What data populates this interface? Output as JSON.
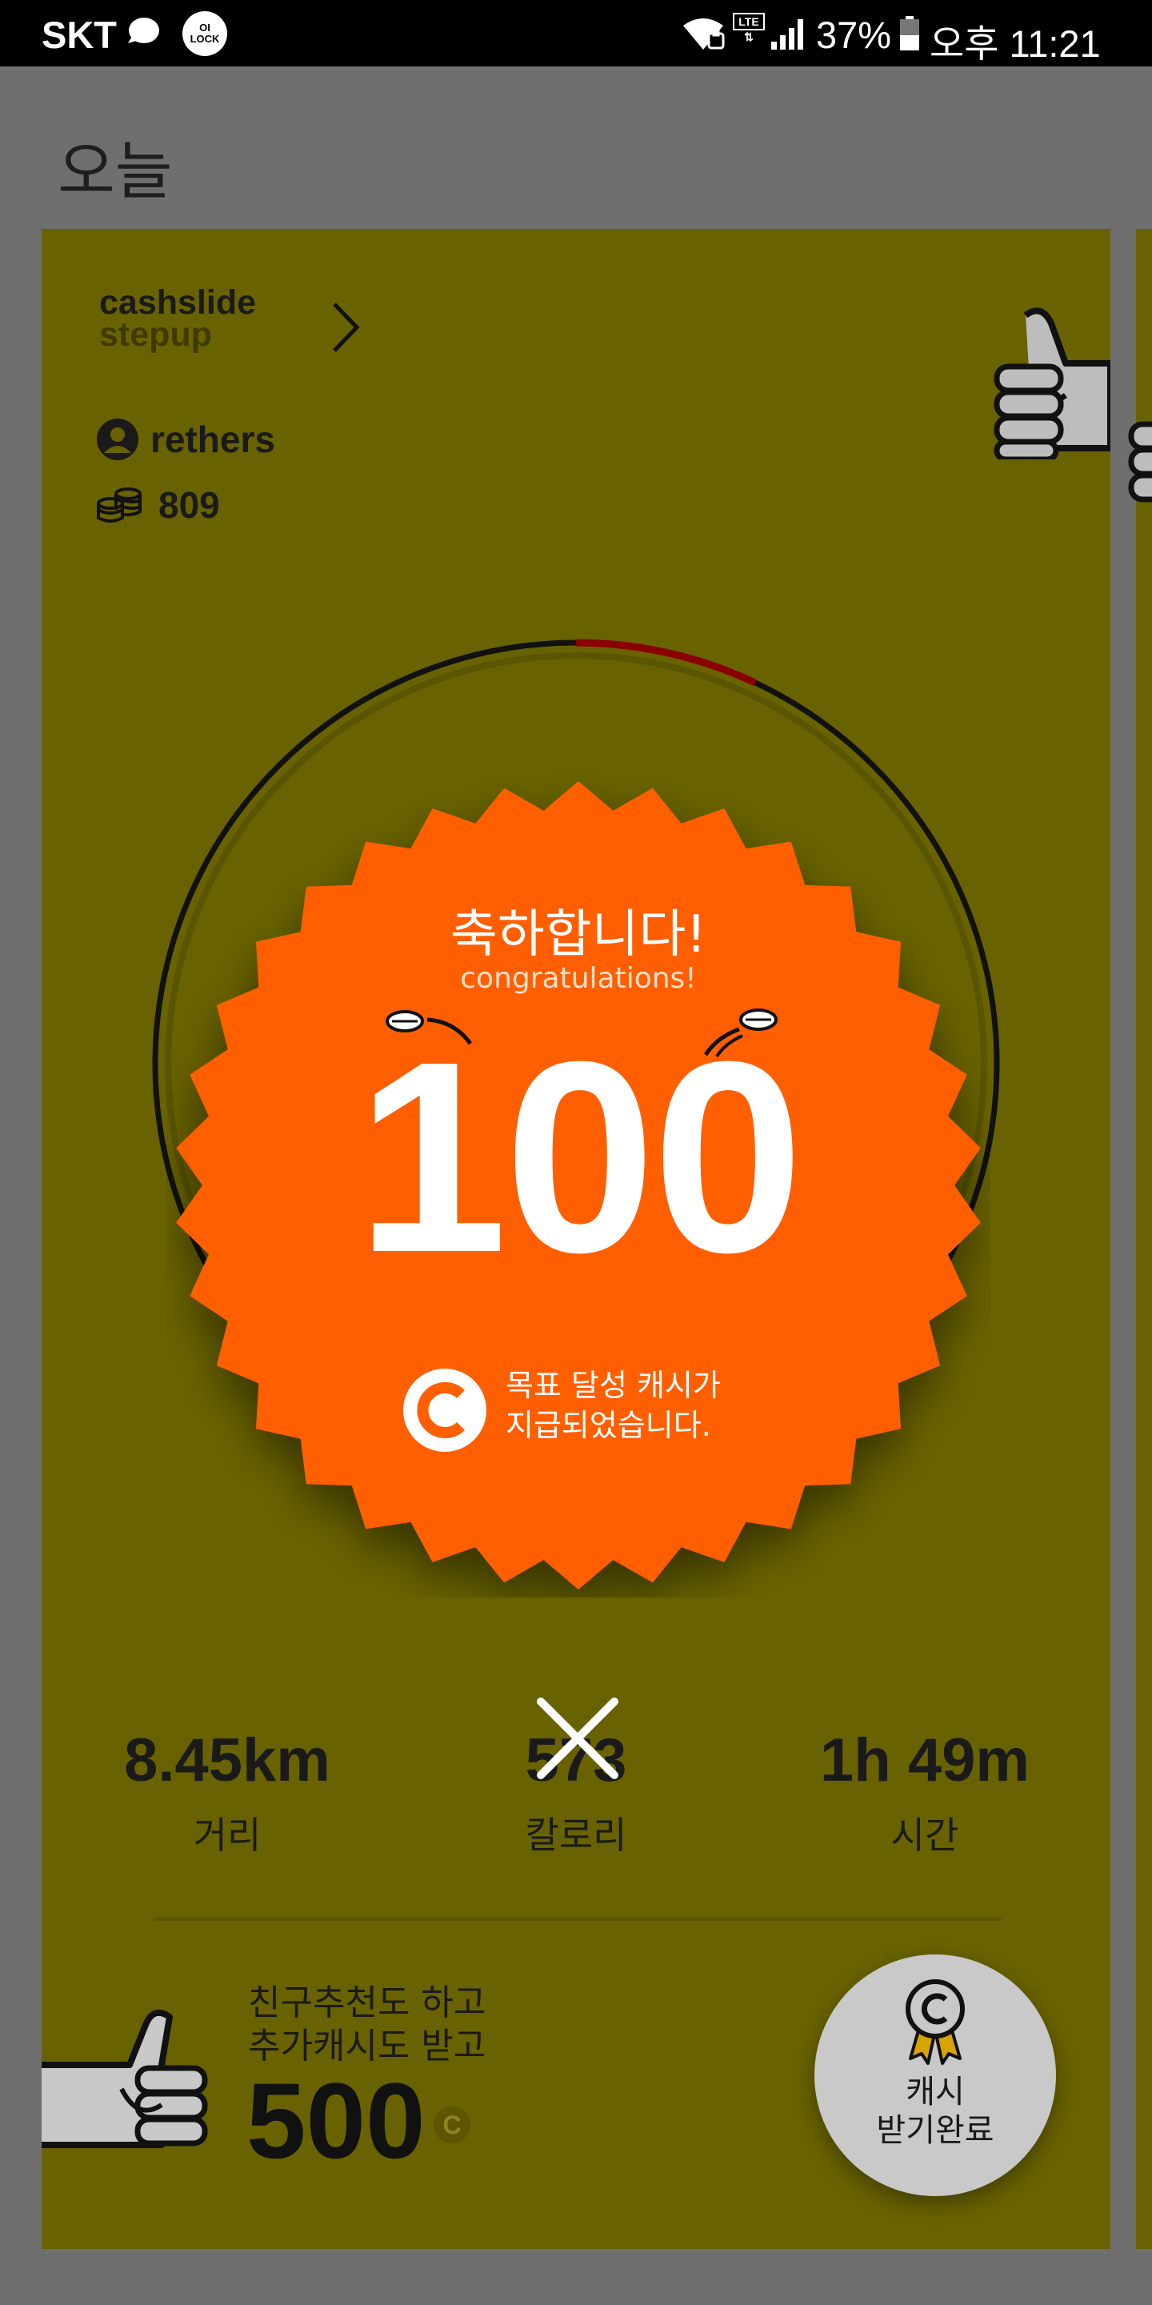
{
  "status_bar": {
    "carrier": "SKT",
    "lock_app": "OI\nLOCK",
    "network": "LTE",
    "battery_percent": "37%",
    "time": "오후 11:21"
  },
  "page": {
    "title": "오늘"
  },
  "card": {
    "brand_line1": "cashslide",
    "brand_line2": "stepup",
    "user_name": "rethers",
    "coin_balance": "809",
    "progress_fraction": 0.07,
    "colors": {
      "card": "#686200",
      "badge": "#ff5f00",
      "progress": "#8a0000"
    }
  },
  "reward": {
    "title": "축하합니다!",
    "subtitle": "congratulations!",
    "amount": "100",
    "message_line1": "목표 달성 캐시가",
    "message_line2": "지급되었습니다."
  },
  "stats": {
    "distance": {
      "value": "8.45km",
      "label": "거리"
    },
    "calorie": {
      "value": "573",
      "label": "칼로리"
    },
    "time": {
      "value": "1h 49m",
      "label": "시간"
    }
  },
  "promo": {
    "line1": "친구추천도 하고",
    "line2": "추가캐시도 받고",
    "amount": "500",
    "currency_symbol": "C"
  },
  "claim_button": {
    "line1": "캐시",
    "line2": "받기완료"
  },
  "icons": {
    "brand_chevron": "chevron-right-icon",
    "user": "user-icon",
    "coins": "coins-icon",
    "thumb": "thumbs-up-icon",
    "close": "close-icon",
    "cash": "cash-c-icon",
    "ribbon": "ribbon-badge-icon"
  }
}
